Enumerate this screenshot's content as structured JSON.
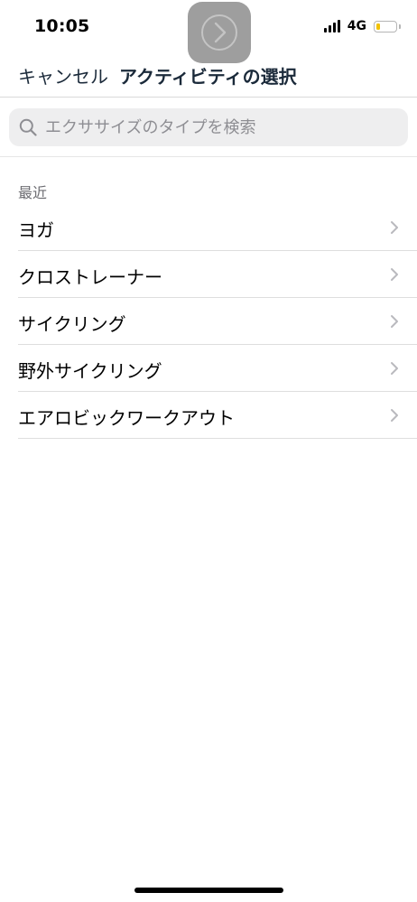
{
  "status_bar": {
    "time": "10:05",
    "network": "4G",
    "battery_level": 0.2,
    "colors": {
      "battery_fill": "#f2c200"
    }
  },
  "assistive_touch": {
    "icon": "chevron-right-circle-icon"
  },
  "nav": {
    "cancel_label": "キャンセル",
    "title": "アクティビティの選択"
  },
  "search": {
    "placeholder": "エクササイズのタイプを検索",
    "value": "",
    "icon": "search-icon"
  },
  "sections": [
    {
      "header": "最近",
      "items": [
        {
          "label": "ヨガ"
        },
        {
          "label": "クロストレーナー"
        },
        {
          "label": "サイクリング"
        },
        {
          "label": "野外サイクリング"
        },
        {
          "label": "エアロビックワークアウト"
        }
      ]
    }
  ]
}
